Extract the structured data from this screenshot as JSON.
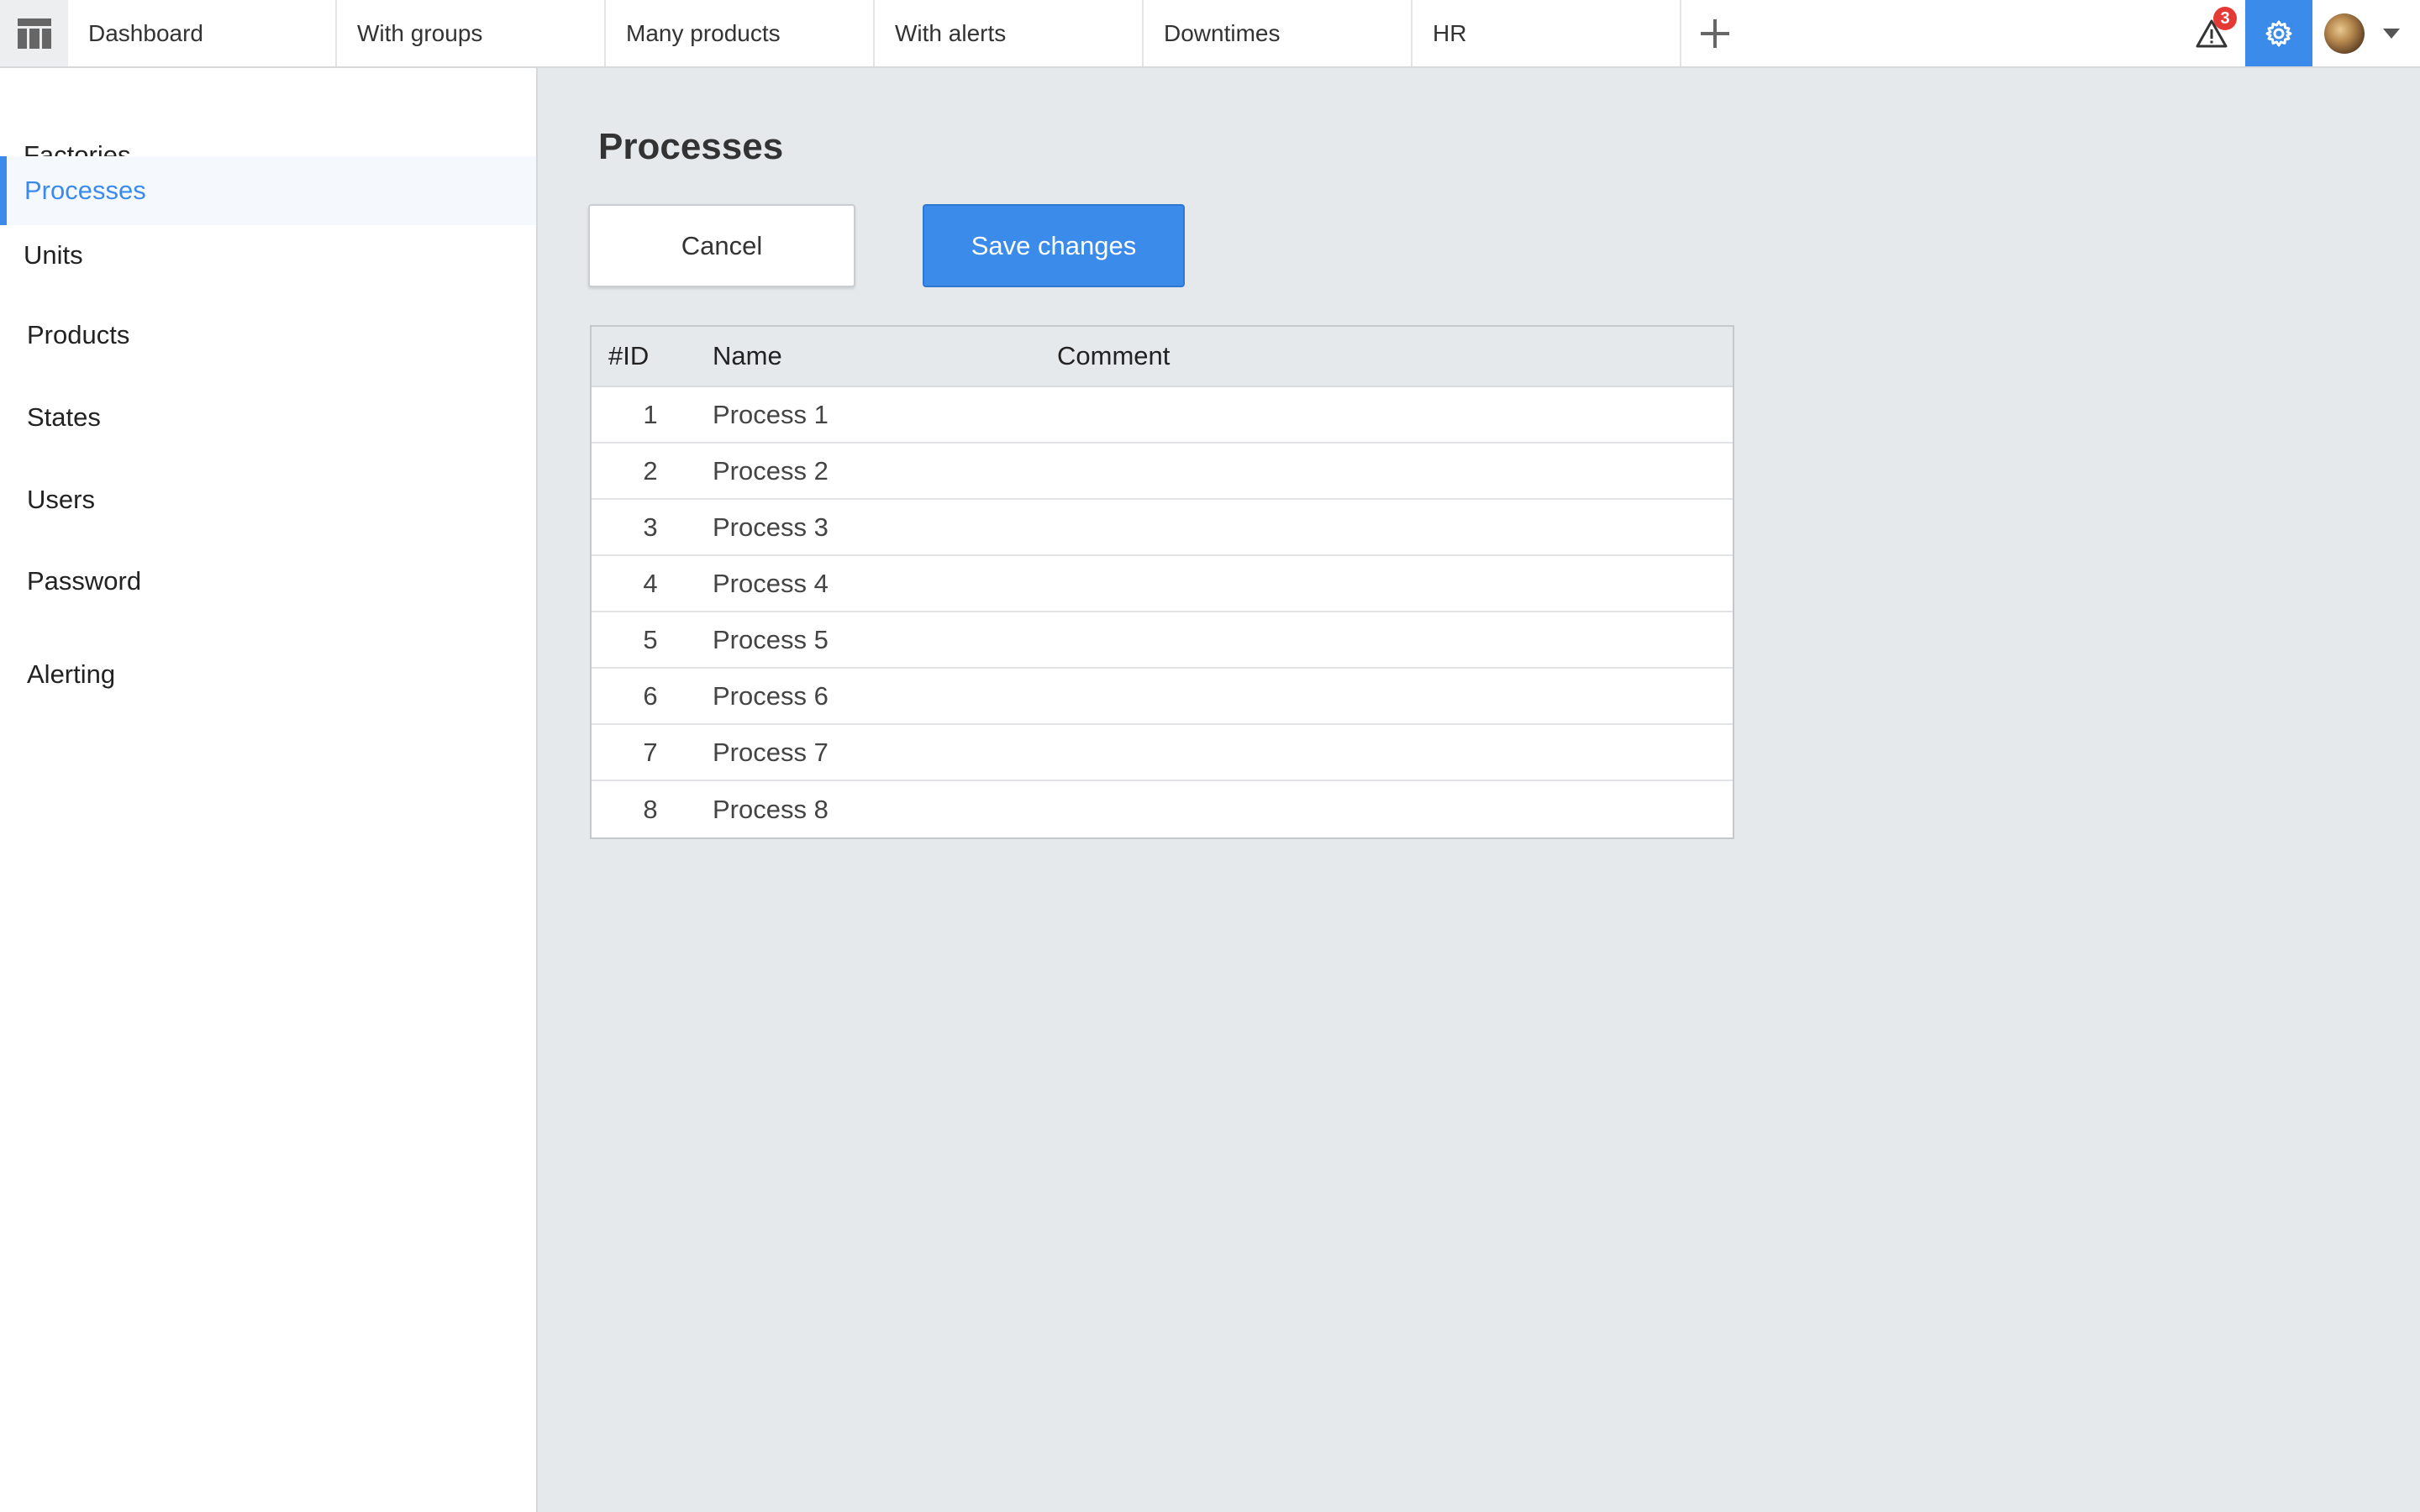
{
  "topbar": {
    "tabs": [
      {
        "label": "Dashboard"
      },
      {
        "label": "With groups"
      },
      {
        "label": "Many products"
      },
      {
        "label": "With alerts"
      },
      {
        "label": "Downtimes"
      },
      {
        "label": "HR"
      }
    ],
    "alert_count": "3",
    "accent_color": "#3b8beb",
    "badge_color": "#e53935",
    "icons": [
      "grid-menu-icon",
      "plus-icon",
      "warning-icon",
      "gear-icon",
      "avatar",
      "caret-down-icon"
    ]
  },
  "sidebar": {
    "items": [
      {
        "label": "Factories",
        "active": false
      },
      {
        "label": "Processes",
        "active": true
      },
      {
        "label": "Units",
        "active": false
      },
      {
        "label": "Products",
        "active": false
      },
      {
        "label": "States",
        "active": false
      },
      {
        "label": "Users",
        "active": false
      },
      {
        "label": "Password",
        "active": false
      },
      {
        "label": "Alerting",
        "active": false
      }
    ]
  },
  "main": {
    "title": "Processes",
    "cancel_label": "Cancel",
    "save_label": "Save changes",
    "table": {
      "columns": [
        "#ID",
        "Name",
        "Comment"
      ],
      "rows": [
        {
          "id": "1",
          "name": "Process 1",
          "comment": ""
        },
        {
          "id": "2",
          "name": "Process 2",
          "comment": ""
        },
        {
          "id": "3",
          "name": "Process 3",
          "comment": ""
        },
        {
          "id": "4",
          "name": "Process 4",
          "comment": ""
        },
        {
          "id": "5",
          "name": "Process 5",
          "comment": ""
        },
        {
          "id": "6",
          "name": "Process 6",
          "comment": ""
        },
        {
          "id": "7",
          "name": "Process 7",
          "comment": ""
        },
        {
          "id": "8",
          "name": "Process 8",
          "comment": ""
        }
      ]
    }
  }
}
